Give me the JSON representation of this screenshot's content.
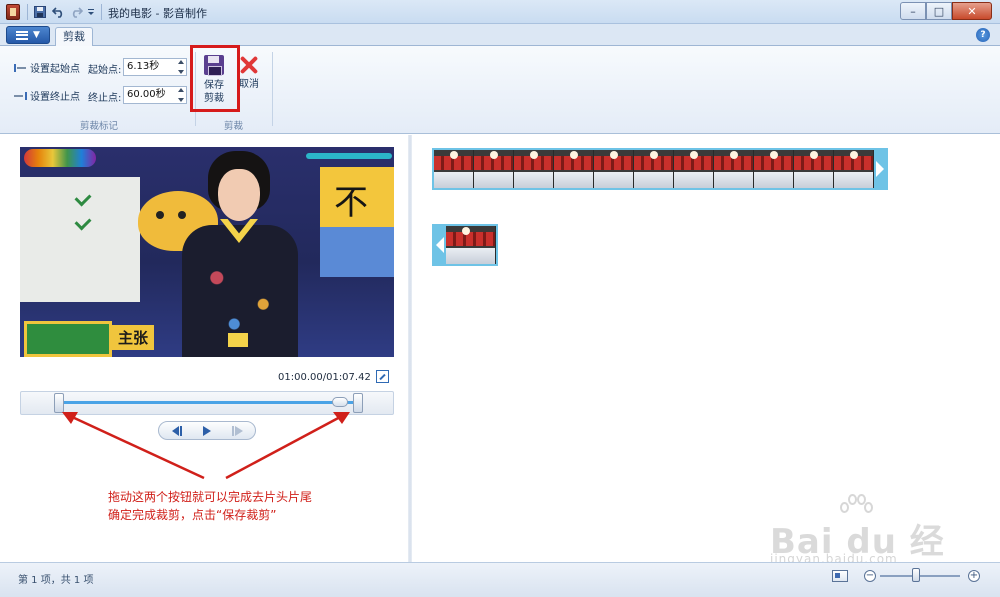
{
  "window": {
    "title": "我的电影 - 影音制作",
    "minimize": "–",
    "maximize": "□",
    "close": "✕"
  },
  "ribbon": {
    "active_tab": "剪裁",
    "help": "?",
    "set_start_label": "设置起始点",
    "set_end_label": "设置终止点",
    "start_point_label": "起始点:",
    "start_point_value": "6.13秒",
    "end_point_label": "终止点:",
    "end_point_value": "60.00秒",
    "group_trim_markers": "剪裁标记",
    "save_trim_line1": "保存",
    "save_trim_line2": "剪裁",
    "cancel_label": "取消",
    "group_trim": "剪裁"
  },
  "preview": {
    "time_readout": "01:00.00/01:07.42",
    "video_caption": "主张",
    "video_sign": "不",
    "trim_start_fraction": 0.091,
    "trim_end_fraction": 0.89
  },
  "annotation": {
    "line1": "拖动这两个按钮就可以完成去片头片尾",
    "line2": "确定完成裁剪，点击“保存裁剪”",
    "color": "#d0201a"
  },
  "status": {
    "item_count": "第 1 项，共 1 项"
  },
  "zoom": {
    "minus": "−",
    "plus": "+"
  },
  "watermark": {
    "brand": "Bai du 经验",
    "url": "jingyan.baidu.com"
  },
  "colors": {
    "highlight_box": "#d61b1b",
    "clip_border": "#6ec3e6",
    "trim_line": "#4aa3e6"
  }
}
